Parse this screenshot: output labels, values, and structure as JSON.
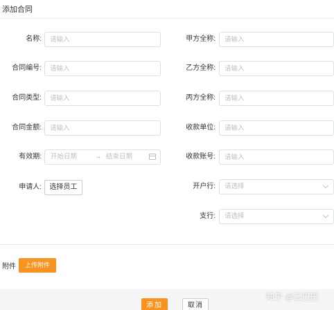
{
  "header": {
    "title": "添加合同"
  },
  "form": {
    "left": {
      "name": {
        "label": "名称:",
        "placeholder": "请输入"
      },
      "contract_no": {
        "label": "合同编号:",
        "placeholder": "请输入"
      },
      "contract_type": {
        "label": "合同类型:",
        "placeholder": "请输入"
      },
      "amount": {
        "label": "合同金额:",
        "placeholder": "请输入"
      },
      "validity": {
        "label": "有效期:",
        "start_placeholder": "开始日期",
        "separator": "→",
        "end_placeholder": "结束日期"
      },
      "applicant": {
        "label": "申请人:",
        "button": "选择员工"
      }
    },
    "right": {
      "party_a": {
        "label": "甲方全称:",
        "placeholder": "请输入"
      },
      "party_b": {
        "label": "乙方全称:",
        "placeholder": "请输入"
      },
      "party_c": {
        "label": "丙方全称:",
        "placeholder": "请输入"
      },
      "payee_unit": {
        "label": "收款单位:",
        "placeholder": "请输入"
      },
      "payee_account": {
        "label": "收款账号:",
        "placeholder": "请输入"
      },
      "bank": {
        "label": "开户行:",
        "placeholder": "请选择"
      },
      "branch": {
        "label": "支行:",
        "placeholder": "请选择"
      }
    }
  },
  "attachment": {
    "label": "附件",
    "upload_button": "上传附件"
  },
  "footer": {
    "add_button": "添加",
    "cancel_button": "取消"
  },
  "watermark": "知乎 @云巴巴",
  "colors": {
    "accent": "#f7931e",
    "border": "#dcdfe6"
  }
}
